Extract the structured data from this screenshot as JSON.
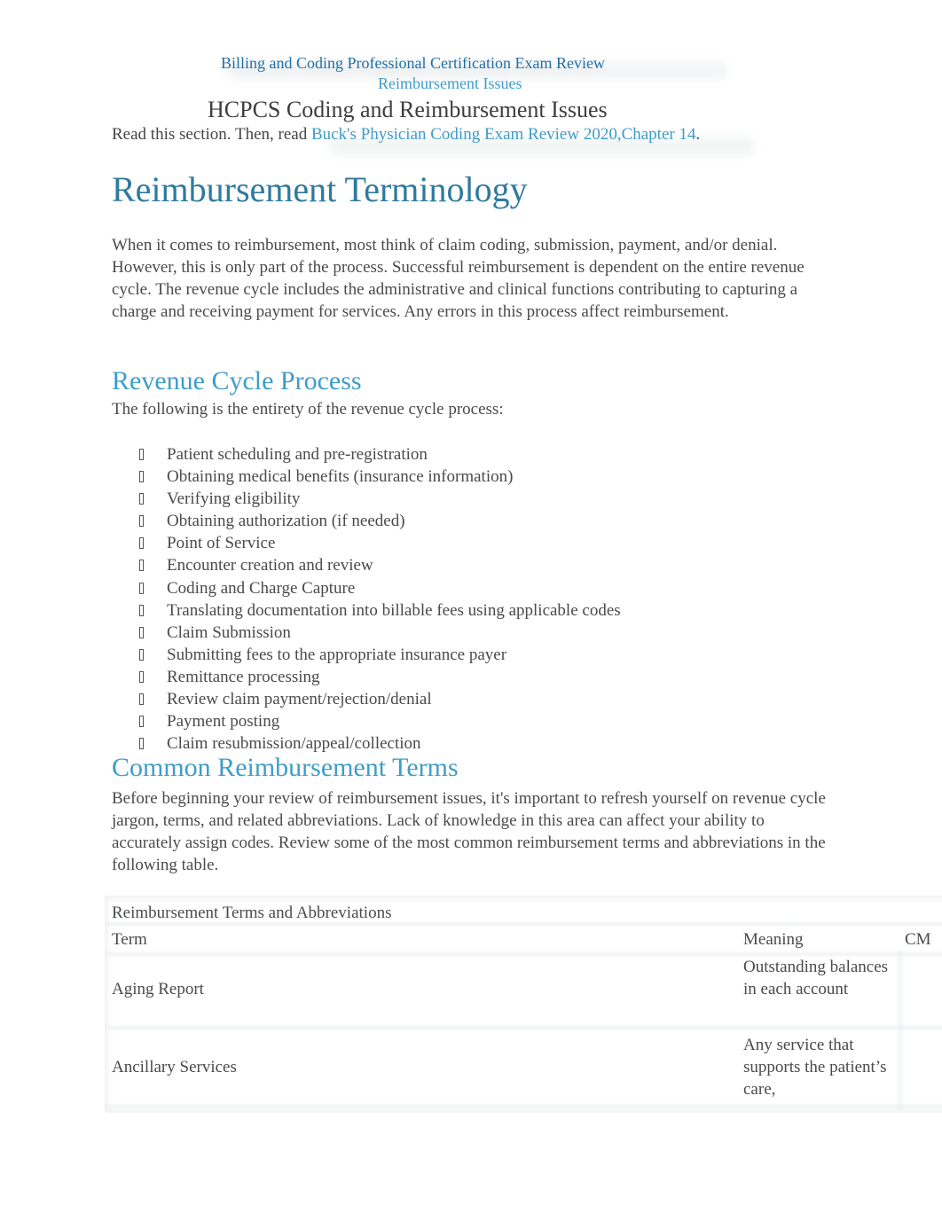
{
  "header": {
    "course_title": "Billing and Coding Professional Certification Exam Review",
    "unit_title": "Reimbursement Issues",
    "lesson_title": "HCPCS Coding and Reimbursement Issues",
    "intro_prefix": "Read this section. Then, read ",
    "intro_link": "Buck's Physician Coding Exam Review 2020,Chapter 14",
    "intro_suffix": "."
  },
  "sections": {
    "terminology": {
      "heading": "Reimbursement Terminology",
      "paragraph": "When it comes to reimbursement, most think of claim coding, submission, payment, and/or denial. However, this is only part of the process. Successful reimbursement is dependent on the entire revenue cycle. The revenue cycle includes the administrative and clinical functions contributing to capturing a charge and receiving payment for services. Any errors in this process affect reimbursement."
    },
    "revenue_cycle": {
      "heading": "Revenue Cycle Process",
      "lead": "The following is the entirety of the revenue cycle process:",
      "items": [
        "Patient scheduling and pre-registration",
        "Obtaining medical benefits (insurance information)",
        "Verifying eligibility",
        "Obtaining authorization (if needed)",
        "Point of Service",
        "Encounter creation and review",
        "Coding and Charge Capture",
        "Translating documentation into billable fees using applicable codes",
        "Claim Submission",
        "Submitting fees to the appropriate insurance payer",
        "Remittance processing",
        "Review claim payment/rejection/denial",
        "Payment posting",
        "Claim resubmission/appeal/collection"
      ]
    },
    "common_terms": {
      "heading": "Common Reimbursement Terms",
      "paragraph": "Before beginning your review of reimbursement issues, it's important to refresh yourself on revenue cycle jargon, terms, and related abbreviations. Lack of knowledge in this area can affect your ability to accurately assign codes. Review some of the most common reimbursement terms and abbreviations in the following table."
    }
  },
  "table": {
    "caption": "Reimbursement Terms and Abbreviations",
    "columns": [
      "Term",
      "Meaning",
      "CM"
    ],
    "rows": [
      {
        "term": "Aging Report",
        "meaning": "Outstanding balances in each account",
        "cm": ""
      },
      {
        "term": "Ancillary Services",
        "meaning": "Any service that supports the patient’s care,",
        "cm": ""
      }
    ]
  }
}
